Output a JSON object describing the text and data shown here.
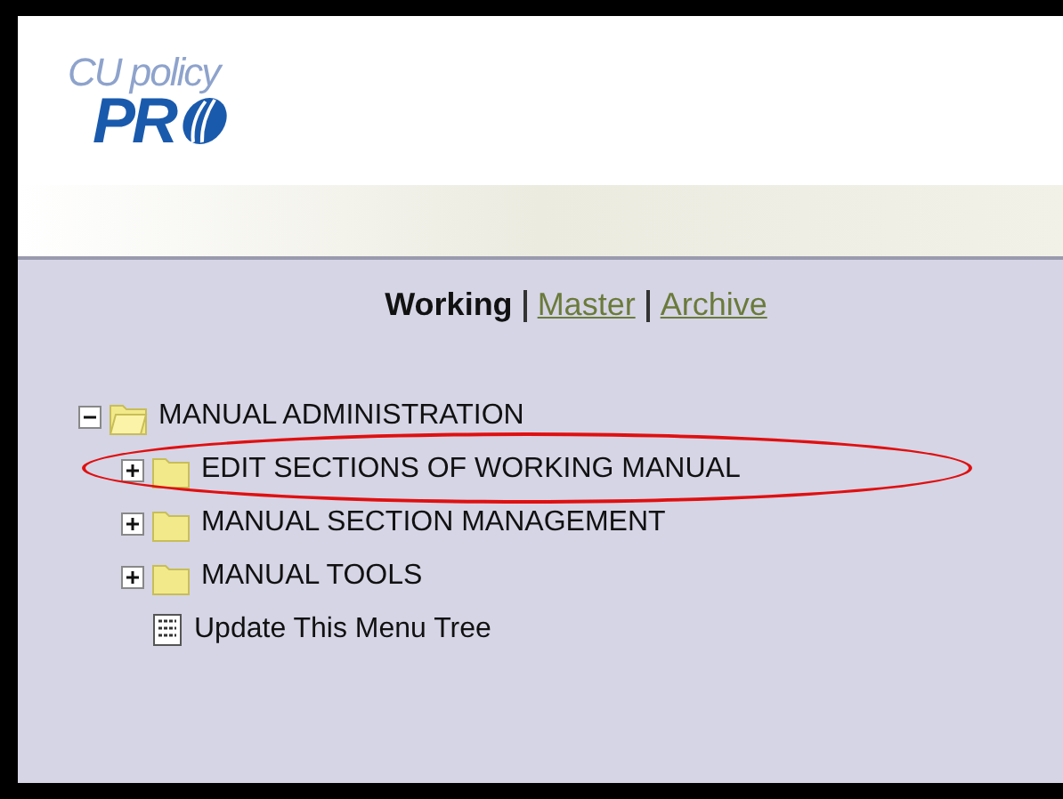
{
  "logo": {
    "top": "CU policy",
    "main": "PR"
  },
  "tabs": [
    {
      "label": "Working",
      "selected": true
    },
    {
      "label": "Master",
      "selected": false
    },
    {
      "label": "Archive",
      "selected": false
    }
  ],
  "tree": [
    {
      "kind": "folder",
      "label": "MANUAL ADMINISTRATION",
      "expanded": true,
      "highlighted": false,
      "children": [
        {
          "kind": "folder",
          "label": "EDIT SECTIONS OF WORKING MANUAL",
          "expanded": false,
          "highlighted": true
        },
        {
          "kind": "folder",
          "label": "MANUAL SECTION MANAGEMENT",
          "expanded": false,
          "highlighted": false
        },
        {
          "kind": "folder",
          "label": "MANUAL TOOLS",
          "expanded": false,
          "highlighted": false
        },
        {
          "kind": "page",
          "label": "Update This Menu Tree",
          "highlighted": false
        }
      ]
    }
  ]
}
